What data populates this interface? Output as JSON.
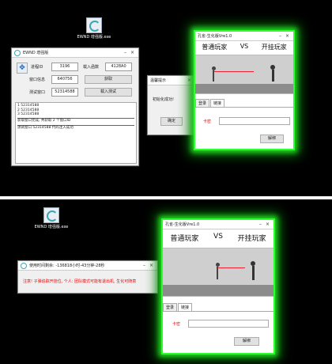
{
  "desktop": {
    "icon_label_top": "EWND 增强版.exe",
    "icon_label_bottom": "EWND 增强版.exe"
  },
  "ewnd_window": {
    "title": "EWND 增强版",
    "process_id_label": "进程ID",
    "process_id_value": "3196",
    "loaded_module_label": "载入函数",
    "loaded_module_value": "4128A0",
    "window_info_label": "窗口信息",
    "window_info_value": "640756",
    "get_button": "获取",
    "test_window_label": "测试窗口",
    "test_window_value": "52314588",
    "load_test_button": "载入测试",
    "log_lines": [
      "1  52314588",
      "2  52314588",
      "3  52314588"
    ],
    "log_line_a": "获取窗口完成, 共获取 2 个窗口ID",
    "log_line_b": "测试窗口 52314588 代码注入成功"
  },
  "dialog": {
    "title": "温馨提示",
    "message": "初始化成功!",
    "ok_button": "确定"
  },
  "game_top": {
    "title": "孔雀-生化版Vre1.0",
    "left_player": "普通玩家",
    "vs": "VS",
    "right_player": "开挂玩家",
    "tab_login": "登录",
    "tab_settings": "链接",
    "card_label": "卡密",
    "unbind_button": "解绑"
  },
  "warning_window": {
    "title": "使用时间剩余: -136818小时-43分钟-28秒",
    "warning_text": "注意! 子弹追踪开挂位, 个人: 团队模式可能有退出机, 生化可随意"
  },
  "game_bottom": {
    "title": "孔雀-生化版Vre1.0",
    "left_player": "普通玩家",
    "vs": "VS",
    "right_player": "开挂玩家",
    "tab_login": "登录",
    "tab_settings": "链接",
    "card_label": "卡密",
    "unbind_button": "解绑"
  }
}
